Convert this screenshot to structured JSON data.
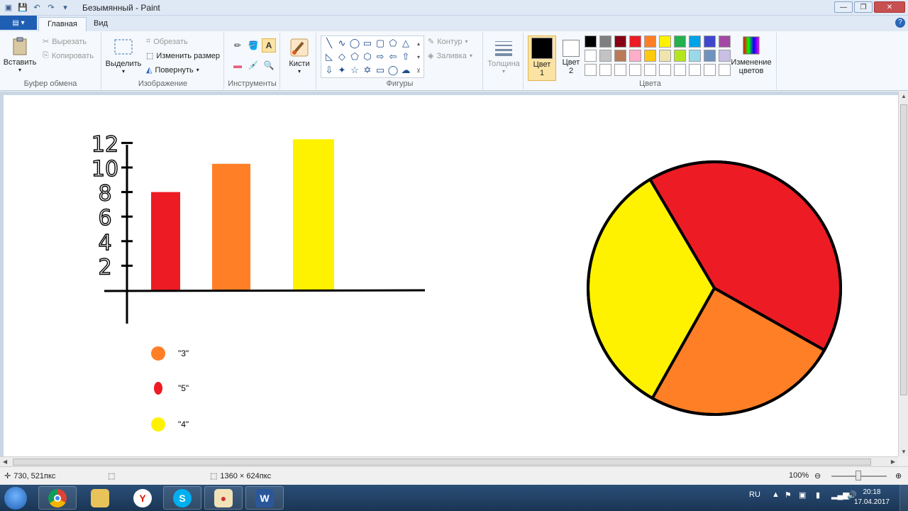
{
  "window": {
    "title": "Безымянный - Paint"
  },
  "tabs": [
    {
      "label": "Главная"
    },
    {
      "label": "Вид"
    }
  ],
  "ribbon": {
    "clipboard": {
      "paste": "Вставить",
      "cut": "Вырезать",
      "copy": "Копировать",
      "group": "Буфер обмена"
    },
    "image": {
      "select": "Выделить",
      "crop": "Обрезать",
      "resize": "Изменить размер",
      "rotate": "Повернуть",
      "group": "Изображение"
    },
    "tools": {
      "group": "Инструменты"
    },
    "brushes": {
      "label": "Кисти"
    },
    "shapes": {
      "outline": "Контур",
      "fill": "Заливка",
      "group": "Фигуры"
    },
    "size": {
      "label": "Толщина"
    },
    "colors": {
      "color1_line1": "Цвет",
      "color1_line2": "1",
      "color2_line1": "Цвет",
      "color2_line2": "2",
      "edit_line1": "Изменение",
      "edit_line2": "цветов",
      "group": "Цвета",
      "color1": "#000000",
      "color2": "#ffffff",
      "palette": [
        "#000000",
        "#7f7f7f",
        "#880015",
        "#ed1c24",
        "#ff7f27",
        "#fff200",
        "#22b14c",
        "#00a2e8",
        "#3f48cc",
        "#a349a4",
        "#ffffff",
        "#c3c3c3",
        "#b97a57",
        "#ffaec9",
        "#ffc90e",
        "#efe4b0",
        "#b5e61d",
        "#99d9ea",
        "#7092be",
        "#c8bfe7"
      ]
    }
  },
  "drawing": {
    "axis_labels": [
      "12",
      "10",
      "8",
      "6",
      "4",
      "2"
    ],
    "bars": [
      {
        "value": 8,
        "color": "#ed1c24"
      },
      {
        "value": 10.3,
        "color": "#ff7f27"
      },
      {
        "value": 12.3,
        "color": "#fff200"
      }
    ],
    "legend": [
      {
        "label": "\"3\"",
        "color": "#ff7f27"
      },
      {
        "label": "\"5\"",
        "color": "#ed1c24"
      },
      {
        "label": "\"4\"",
        "color": "#fff200"
      }
    ],
    "pie": [
      {
        "value": 5,
        "color": "#ed1c24"
      },
      {
        "value": 3,
        "color": "#ff7f27"
      },
      {
        "value": 4,
        "color": "#fff200"
      }
    ]
  },
  "status": {
    "cursor": "730, 521пкс",
    "size": "1360 × 624пкс",
    "zoom": "100%"
  },
  "taskbar": {
    "lang": "RU",
    "time": "20:18",
    "date": "17.04.2017"
  }
}
